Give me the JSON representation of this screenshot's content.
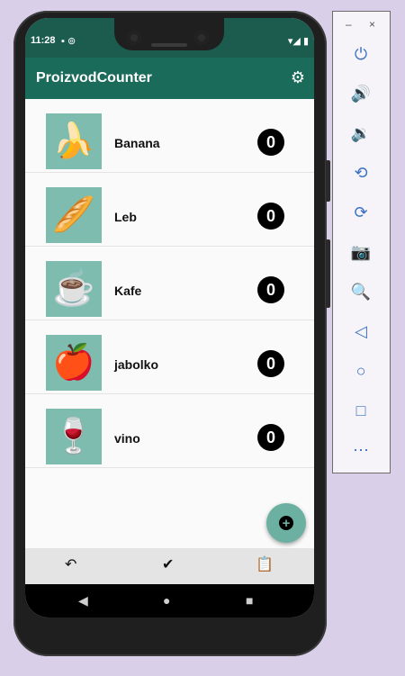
{
  "status": {
    "time": "11:28",
    "left_icons": "▪ ⊚",
    "right_icons": "▾◢ ▮"
  },
  "app": {
    "title": "ProizvodCounter",
    "settings_icon": "gear-icon"
  },
  "items": [
    {
      "name": "Banana",
      "count": "0",
      "icon": "banana-icon",
      "glyph": "🍌"
    },
    {
      "name": "Leb",
      "count": "0",
      "icon": "bread-icon",
      "glyph": "🥖"
    },
    {
      "name": "Kafe",
      "count": "0",
      "icon": "coffee-cup-icon",
      "glyph": "☕"
    },
    {
      "name": "jabolko",
      "count": "0",
      "icon": "apple-icon",
      "glyph": "🍎"
    },
    {
      "name": "vino",
      "count": "0",
      "icon": "wine-icon",
      "glyph": "🍷"
    }
  ],
  "fab": {
    "glyph": "+"
  },
  "bottom_nav": {
    "back_glyph": "↶",
    "check_glyph": "✔",
    "clipboard_glyph": "📋"
  },
  "system_nav": {
    "back": "◀",
    "home": "●",
    "recents": "■"
  },
  "emulator_toolbar": {
    "window_buttons": {
      "minimize": "–",
      "close": "×"
    },
    "tools": [
      {
        "name": "power-icon",
        "glyph": "⏻"
      },
      {
        "name": "volume-up-icon",
        "glyph": "🔊"
      },
      {
        "name": "volume-down-icon",
        "glyph": "🔉"
      },
      {
        "name": "rotate-left-icon",
        "glyph": "⟲"
      },
      {
        "name": "rotate-right-icon",
        "glyph": "⟳"
      },
      {
        "name": "camera-icon",
        "glyph": "📷"
      },
      {
        "name": "zoom-icon",
        "glyph": "🔍"
      },
      {
        "name": "back-icon",
        "glyph": "◁"
      },
      {
        "name": "home-icon",
        "glyph": "○"
      },
      {
        "name": "overview-icon",
        "glyph": "□"
      },
      {
        "name": "more-icon",
        "glyph": "⋯"
      }
    ]
  },
  "colors": {
    "app_bar": "#1b6b5b",
    "status_bar": "#1b5c4f",
    "thumb_bg": "#7dbcaf",
    "fab": "#6cb0a2",
    "background": "#d9cfe8"
  }
}
